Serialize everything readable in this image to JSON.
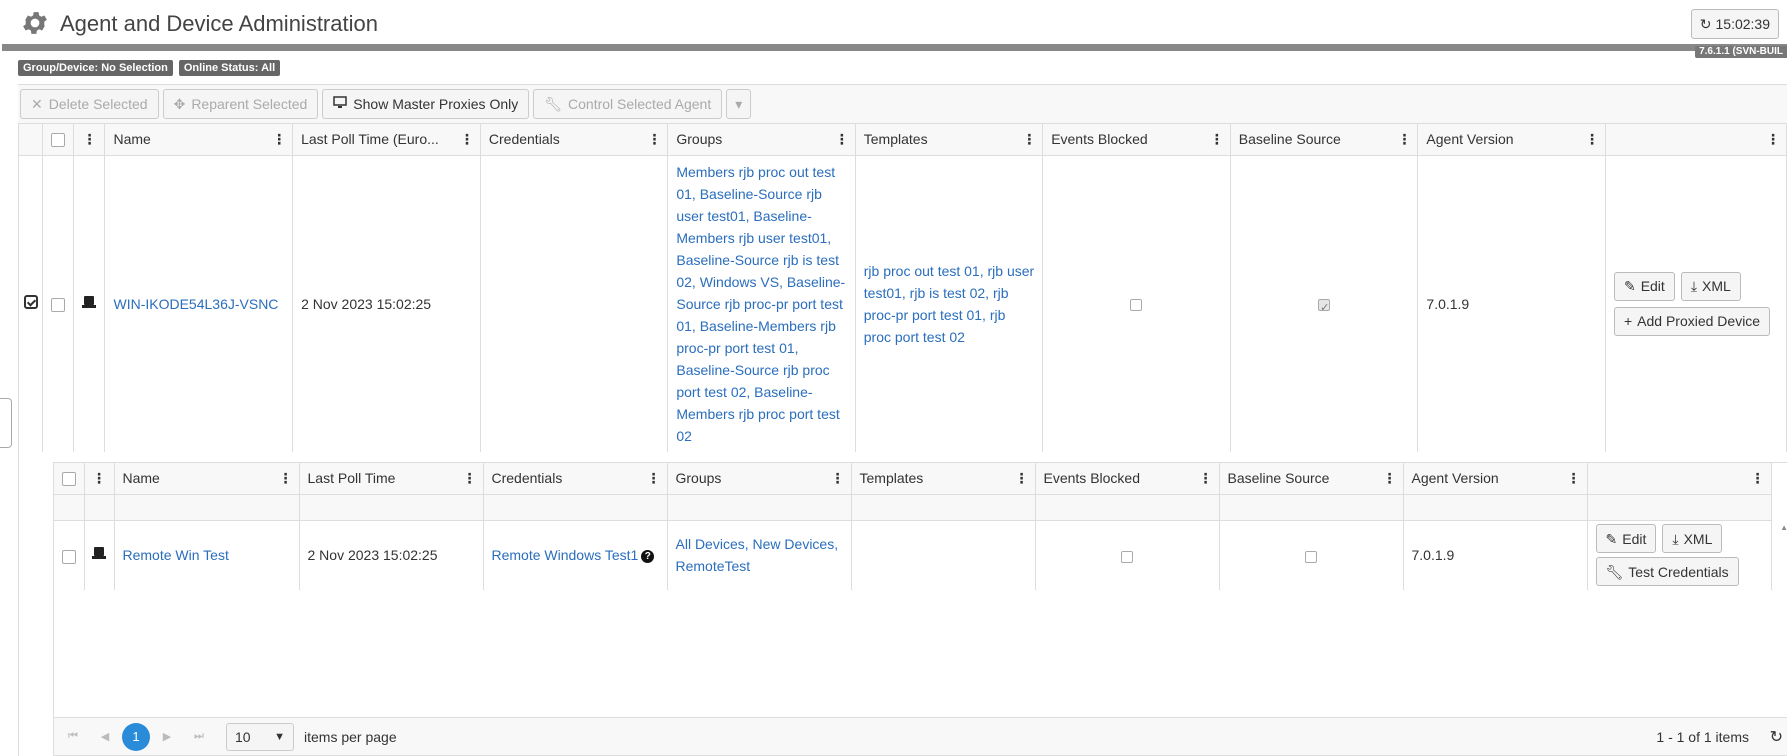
{
  "header": {
    "title": "Agent and Device Administration",
    "clock": "15:02:39",
    "version": "7.6.1.1 (SVN-BUIL"
  },
  "badges": [
    "Group/Device: No Selection",
    "Online Status: All"
  ],
  "toolbar": {
    "delete": "Delete Selected",
    "reparent": "Reparent Selected",
    "show_master": "Show Master Proxies Only",
    "control": "Control Selected Agent"
  },
  "main_grid": {
    "columns": [
      "Name",
      "Last Poll Time (Euro...",
      "Credentials",
      "Groups",
      "Templates",
      "Events Blocked",
      "Baseline Source",
      "Agent Version"
    ],
    "row": {
      "name": "WIN-IKODE54L36J-VSNC",
      "last_poll": "2 Nov 2023 15:02:25",
      "credentials": "",
      "groups": "Members rjb proc out test 01, Baseline-Source rjb user test01, Baseline-Members rjb user test01, Baseline-Source rjb is test 02, Windows VS, Baseline-Source rjb proc-pr port test 01, Baseline-Members rjb proc-pr port test 01, Baseline-Source rjb proc port test 02, Baseline-Members rjb proc port test 02",
      "templates": "rjb proc out test 01, rjb user test01, rjb is test 02, rjb proc-pr port test 01, rjb proc port test 02",
      "agent_version": "7.0.1.9",
      "edit": "Edit",
      "xml": "XML",
      "add_proxied": "Add Proxied Device"
    }
  },
  "sub_grid": {
    "columns": [
      "Name",
      "Last Poll Time",
      "Credentials",
      "Groups",
      "Templates",
      "Events Blocked",
      "Baseline Source",
      "Agent Version"
    ],
    "row": {
      "name": "Remote Win Test",
      "last_poll": "2 Nov 2023 15:02:25",
      "credentials": "Remote Windows Test1",
      "groups": "All Devices, New Devices, RemoteTest",
      "templates": "",
      "agent_version": "7.0.1.9",
      "edit": "Edit",
      "xml": "XML",
      "test_credentials": "Test Credentials"
    },
    "pager": {
      "current_page": "1",
      "per_page": "10",
      "per_page_label": "items per page",
      "info": "1 - 1 of 1 items"
    }
  }
}
